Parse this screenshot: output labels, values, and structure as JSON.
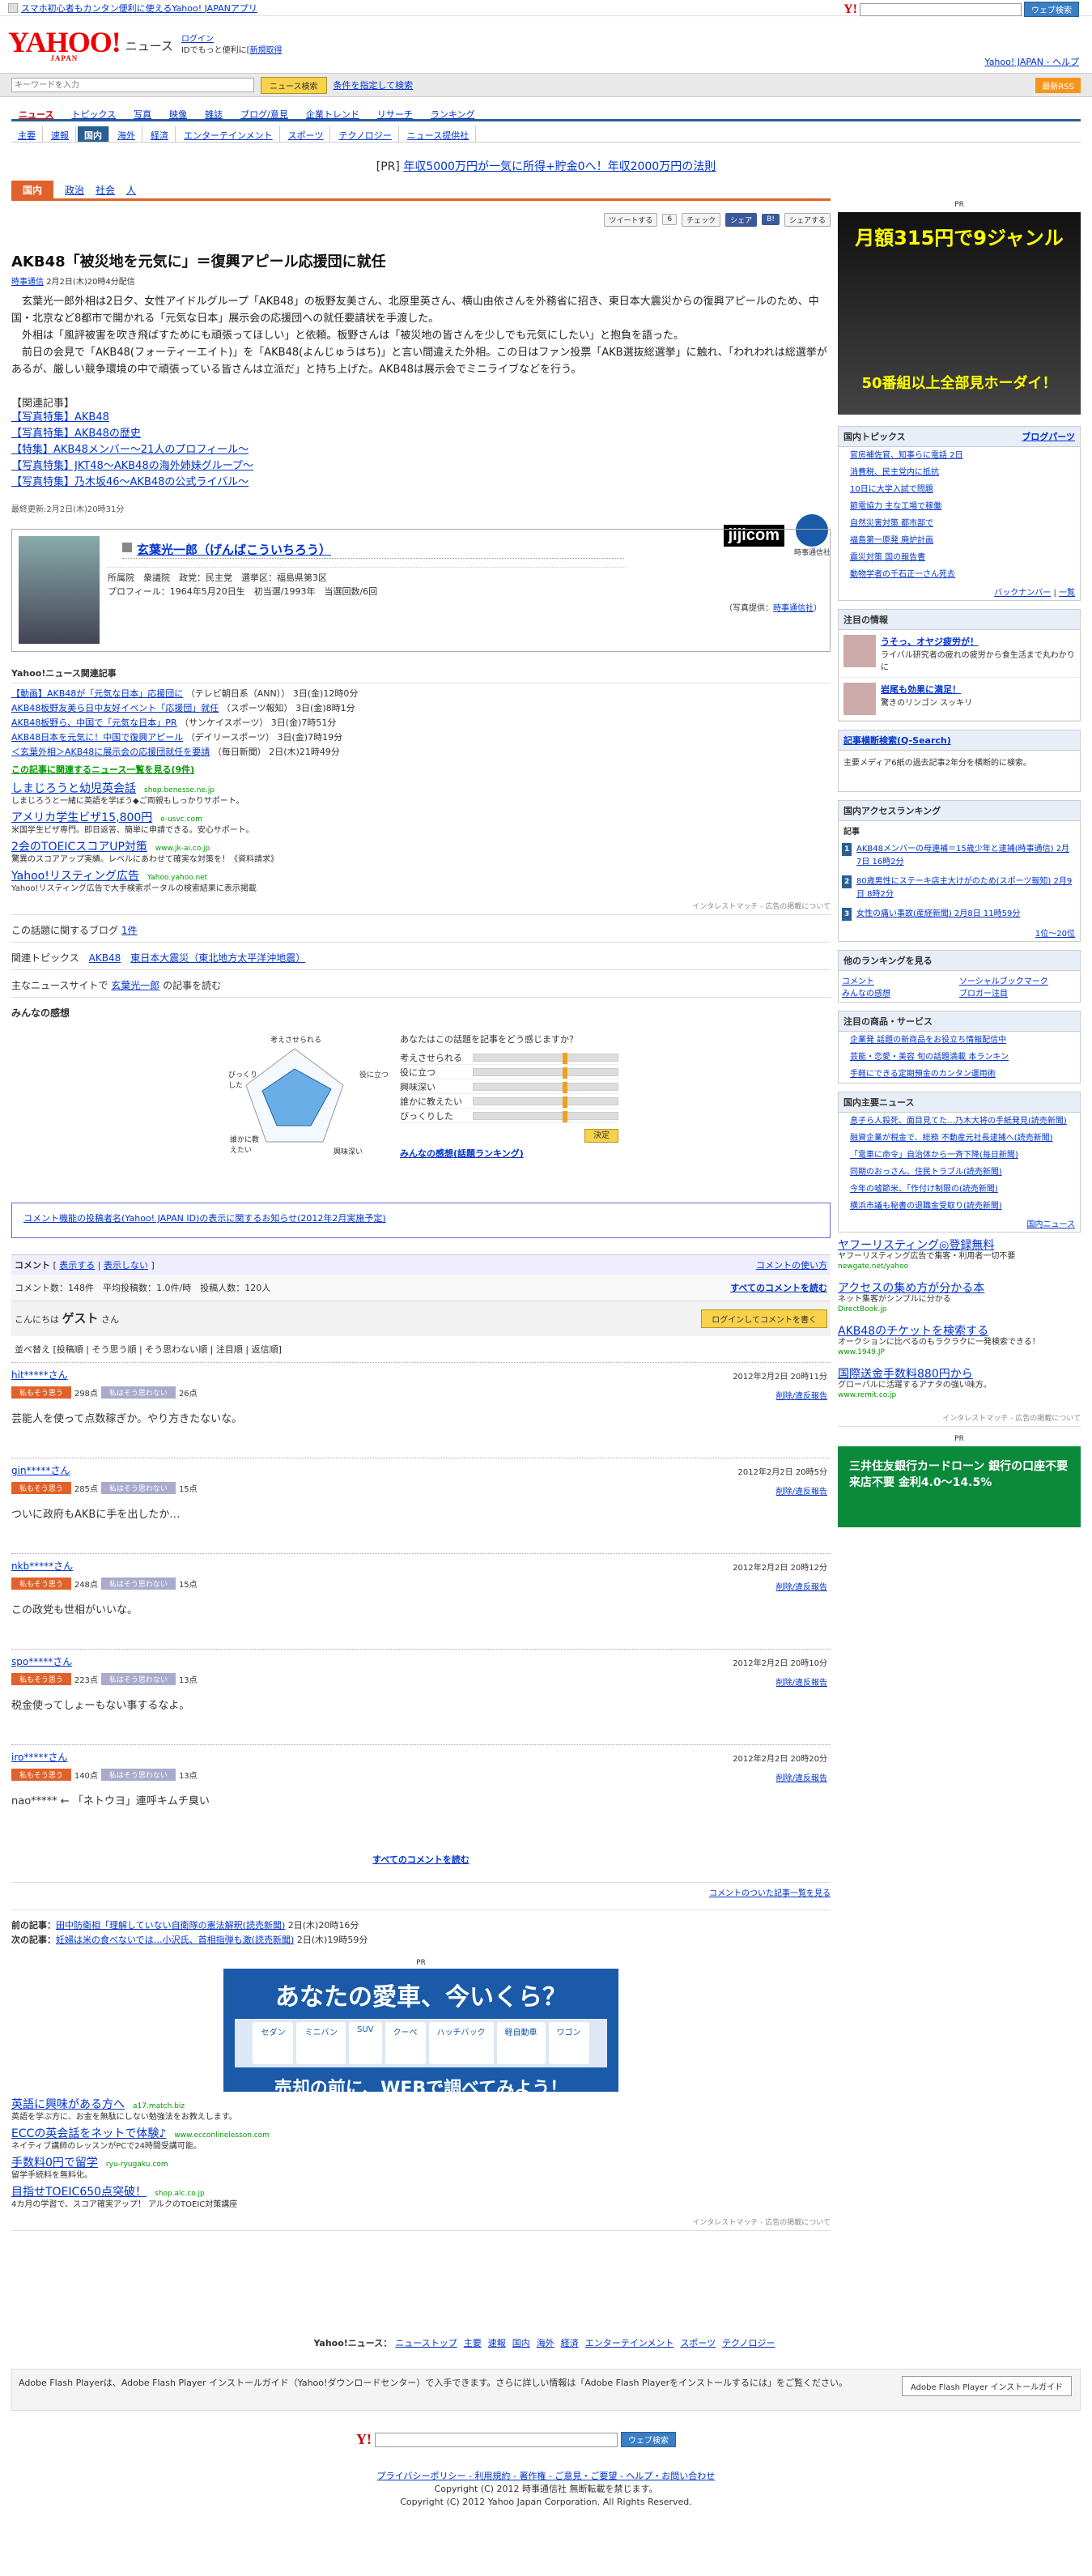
{
  "topbar": {
    "promo": "スマホ初心者もカンタン便利に使えるYahoo! JAPANアプリ",
    "search_btn": "ウェブ検索"
  },
  "header": {
    "logo": "YAHOO!",
    "logo_sub": "JAPAN",
    "section": "ニュース",
    "login": "ログイン",
    "login_sub": "IDでもっと便利に[",
    "signup": "新規取得",
    "right_links": "Yahoo! JAPAN - ヘルプ"
  },
  "keyword": {
    "placeholder": "キーワードを入力",
    "search_btn": "ニュース検索",
    "advanced": "条件を指定して検索",
    "rss": "最新RSS"
  },
  "nav1": [
    "ニュース",
    "トピックス",
    "写真",
    "映像",
    "雑誌",
    "ブログ/意見",
    "企業トレンド",
    "リサーチ",
    "ランキング"
  ],
  "nav2": [
    "主要",
    "速報",
    "国内",
    "海外",
    "経済",
    "エンターテインメント",
    "スポーツ",
    "テクノロジー",
    "ニュース提供社"
  ],
  "pr_line": {
    "prefix": "[PR]",
    "text": "年収5000万円が一気に所得+貯金0へ！年収2000万円の法則"
  },
  "catbar": {
    "active": "国内",
    "items": [
      "政治",
      "社会",
      "人"
    ]
  },
  "share": {
    "tweet": "ツイートする",
    "tweet_count": "6",
    "check": "チェック",
    "fb": "シェア",
    "hatena": "B!",
    "share": "シェアする"
  },
  "article": {
    "headline": "AKB48「被災地を元気に」＝復興アピール応援団に就任",
    "source": "時事通信",
    "date": "2月2日(木)20時4分配信",
    "para1": "玄葉光一郎外相は2日夕、女性アイドルグループ「AKB48」の板野友美さん、北原里英さん、横山由依さんを外務省に招き、東日本大震災からの復興アピールのため、中国・北京など8都市で開かれる「元気な日本」展示会の応援団への就任要請状を手渡した。",
    "para2": "外相は「風評被害を吹き飛ばすためにも頑張ってほしい」と依頼。板野さんは「被災地の皆さんを少しでも元気にしたい」と抱負を語った。",
    "para3": "前日の会見で「AKB48(フォーティーエイト)」を「AKB48(よんじゅうはち)」と言い間違えた外相。この日はファン投票「AKB選抜総選挙」に触れ、「われわれは総選挙があるが、厳しい競争環境の中で頑張っている皆さんは立派だ」と持ち上げた。AKB48は展示会でミニライブなどを行う。",
    "related_head": "【関連記事】",
    "related": [
      "【写真特集】AKB48",
      "【写真特集】AKB48の歴史",
      "【特集】AKB48メンバー〜21人のプロフィール〜",
      "【写真特集】JKT48〜AKB48の海外姉妹グループ〜",
      "【写真特集】乃木坂46〜AKB48の公式ライバル〜"
    ],
    "updated": "最終更新:2月2日(木)20時31分",
    "jiji_logo": "jijicom",
    "jiji_sub": "時事通信社"
  },
  "profile": {
    "name": "玄葉光一郎（げんばこういちろう）",
    "info1": "所属院　衆議院　政党：民主党　選挙区：福島県第3区",
    "info2": "プロフィール：1964年5月20日生　初当選/1993年　当選回数/6回",
    "photo_credit": "（写真提供：",
    "photo_src": "時事通信社",
    "photo_close": "）"
  },
  "yahoo_related": {
    "title": "Yahoo!ニュース関連記事",
    "items": [
      {
        "t": "【動画】AKB48が「元気な日本」応援団に",
        "s": "（テレビ朝日系（ANN））",
        "d": "3日(金)12時0分"
      },
      {
        "t": "AKB48板野友美ら日中友好イベント「応援団」就任",
        "s": "（スポーツ報知）",
        "d": "3日(金)8時1分"
      },
      {
        "t": "AKB48板野ら、中国で「元気な日本」PR",
        "s": "（サンケイスポーツ）",
        "d": "3日(金)7時51分"
      },
      {
        "t": "AKB48日本を元気に！中国で復興アピール",
        "s": "（デイリースポーツ）",
        "d": "3日(金)7時19分"
      },
      {
        "t": "＜玄葉外相＞AKB48に展示会の応援団就任を要請",
        "s": "（毎日新聞）",
        "d": "2日(木)21時49分"
      }
    ],
    "all_link": "この記事に関連するニュース一覧を見る(9件)"
  },
  "ads": [
    {
      "t": "しまじろうと幼児英会話",
      "u": "shop.benesse.ne.jp",
      "d": "しまじろうと一緒に英語を学ぼう◆ご両親もしっかりサポート。"
    },
    {
      "t": "アメリカ学生ビザ15,800円",
      "u": "e-usvc.com",
      "d": "米国学生ビザ専門。即日返答、簡単に申請できる。安心サポート。"
    },
    {
      "t": "2会のTOEICスコアUP対策",
      "u": "www.jk-ai.co.jp",
      "d": "驚異のスコアアップ実績。レベルにあわせて確実な対策を！《資料請求》"
    },
    {
      "t": "Yahoo!リスティング広告",
      "u": "Yahoo.yahoo.net",
      "d": "Yahoo!リスティング広告で大手検索ポータルの検索結果に表示掲載"
    }
  ],
  "adnote": "インタレストマッチ - 広告の掲載について",
  "blog": {
    "label": "この話題に関するブログ",
    "count": "1件"
  },
  "topics": {
    "label": "関連トピックス",
    "items": [
      "AKB48",
      "東日本大震災（東北地方太平洋沖地震）"
    ]
  },
  "mainsite": {
    "label": "主なニュースサイトで",
    "name": "玄葉光一郎",
    "suffix": "の記事を読む"
  },
  "minna": {
    "title": "みんなの感想",
    "question": "あなたはこの話題を記事をどう感じますか？",
    "labels": [
      "考えさせられる",
      "役に立つ",
      "興味深い",
      "誰かに教えたい",
      "びっくりした"
    ],
    "submit": "決定",
    "ranking": "みんなの感想(話題ランキング)"
  },
  "notice": "コメント機能の投稿者名(Yahoo! JAPAN ID)の表示に関するお知らせ(2012年2月実施予定)",
  "comments": {
    "label": "コメント",
    "show": "表示する",
    "hide": "表示しない",
    "howto": "コメントの使い方",
    "count": "コメント数：148件",
    "avg": "平均投稿数：1.0件/時",
    "users": "投稿人数：120人",
    "readall": "すべてのコメントを読む",
    "hello": "こんにちは",
    "guest": "ゲスト",
    "san": "さん",
    "login": "ログインしてコメントを書く",
    "sort": "並べ替え [投稿順 | そう思う順 | そう思わない順 | 注目順 | 返信順]",
    "items": [
      {
        "u": "hit*****さん",
        "d": "2012年2月2日 20時11分",
        "good": "298点",
        "bad": "26点",
        "txt": "芸能人を使って点数稼ぎか。やり方きたないな。"
      },
      {
        "u": "gin*****さん",
        "d": "2012年2月2日 20時5分",
        "good": "285点",
        "bad": "15点",
        "txt": "ついに政府もAKBに手を出したか…"
      },
      {
        "u": "nkb*****さん",
        "d": "2012年2月2日 20時12分",
        "good": "248点",
        "bad": "15点",
        "txt": "この政党も世相がいいな。"
      },
      {
        "u": "spo*****さん",
        "d": "2012年2月2日 20時10分",
        "good": "223点",
        "bad": "13点",
        "txt": "税金使ってしょーもない事するなよ。"
      },
      {
        "u": "iro*****さん",
        "d": "2012年2月2日 20時20分",
        "good": "140点",
        "bad": "13点",
        "txt": "nao***** ← 「ネトウヨ」連呼キムチ臭い"
      }
    ],
    "vote_yes": "私もそう思う",
    "vote_no": "私はそう思わない",
    "report": "削除/違反報告",
    "all": "すべてのコメントを読む",
    "commented": "コメントのついた記事一覧を見る"
  },
  "prevnext": {
    "prev_label": "前の記事：",
    "prev": "田中防衛相「理解していない自衛隊の憲法解釈(読売新聞)",
    "prev_d": "2日(木)20時16分",
    "next_label": "次の記事：",
    "next": "妊婦は米の食べないでは…小沢氏、首相指弾も激(読売新聞)",
    "next_d": "2日(木)19時59分"
  },
  "banner": {
    "pr": "PR",
    "title": "あなたの愛車、今いくら？",
    "cars": [
      "セダン",
      "ミニバン",
      "SUV",
      "クーペ",
      "ハッチバック",
      "軽自動車",
      "ワゴン"
    ],
    "foot": "売却の前に、WEBで調べてみよう！"
  },
  "ads2": [
    {
      "t": "英語に興味がある方へ",
      "u": "a17.match.biz",
      "d": "英語を学ぶ方に、お金を無駄にしない勉強法をお教えします。"
    },
    {
      "t": "ECCの英会話をネットで体験♪",
      "u": "www.ecconlinelesson.com",
      "d": "ネイティブ講師のレッスンがPCで24時間受講可能。"
    },
    {
      "t": "手数料0円で留学",
      "u": "ryu-ryugaku.com",
      "d": "留学手続料を無料化。"
    },
    {
      "t": "目指せTOEIC650点突破！",
      "u": "shop.alc.co.jp",
      "d": "4カ月の学習で、スコア確実アップ！ アルクのTOEIC対策講座"
    }
  ],
  "bottom_nav": {
    "label": "Yahoo!ニュース：",
    "items": [
      "ニューストップ",
      "主要",
      "速報",
      "国内",
      "海外",
      "経済",
      "エンターテインメント",
      "スポーツ",
      "テクノロジー"
    ]
  },
  "flash": {
    "text": "Adobe Flash Playerは、Adobe Flash Player インストールガイド（Yahoo!ダウンロードセンター）で入手できます。さらに詳しい情報は「Adobe Flash Playerをインストールするには」をご覧ください。",
    "btn": "Adobe Flash Player インストールガイド"
  },
  "footer": {
    "links": "プライバシーポリシー - 利用規約 - 著作権 - ご意見・ご要望 - ヘルプ・お問い合わせ",
    "c1": "Copyright (C) 2012 時事通信社 無断転載を禁じます。",
    "c2": "Copyright (C) 2012 Yahoo Japan Corporation. All Rights Reserved."
  },
  "right": {
    "pr": "PR",
    "pr_text": "月額315円で9ジャンル",
    "pr_bottom": "50番組以上全部見ホーダイ！",
    "topics_title": "国内トピックス",
    "topics_link": "ブログパーツ",
    "topics": [
      "官房補佐官、知事らに電話 2日",
      "消費税、民主党内に抵抗",
      "10日に大学入試で問題",
      "節電協力 主な工場で稼働",
      "自然災害対策 都市部で",
      "福島第一原発 廃炉計画",
      "震災対策 国の報告書",
      "動物学者の千石正一さん死去"
    ],
    "back": "バックナンバー",
    "list": "一覧",
    "attn_title": "注目の情報",
    "attn": [
      {
        "t": "うそっ、オヤジ疲労が！",
        "d": "ライバル研究者の疲れの疲労から食生活まで丸わかりに"
      },
      {
        "t": "岩尾も効果に満足！",
        "d": "驚きのリンゴン スッキリ"
      }
    ],
    "kiji_title": "記事横断検索(Q-Search)",
    "kiji": "主要メディア6紙の過去記事2年分を横断的に検索。",
    "rank_title": "国内アクセスランキング",
    "rank_sub": "記事",
    "rank": [
      {
        "n": "1",
        "t": "AKB48メンバーの母連補＝15歳少年と逮捕(時事通信)",
        "d": "2月7日 16時2分"
      },
      {
        "n": "2",
        "t": "80歳男性にステーキ店主大けがのため(スポーツ報知)",
        "d": "2月9日 8時2分"
      },
      {
        "n": "3",
        "t": "女性の痛い事故(産経新聞)",
        "d": "2月8日 11時59分"
      }
    ],
    "rank_all": "1位〜20位",
    "other_title": "他のランキングを見る",
    "others": [
      "コメント",
      "ソーシャルブックマーク",
      "みんなの感想",
      "ブロガー注目"
    ],
    "goods_title": "注目の商品・サービス",
    "goods": [
      "企業発 話題の新商品をお役立ち情報配信中",
      "芸能・恋愛・美容 旬の話題満載 本ランキン",
      "手軽にできる定期預金のカンタン運用術"
    ],
    "major_title": "国内主要ニュース",
    "major": [
      "息子ら人殺死、面目見てた…乃木大将の手紙発見(読売新聞)",
      "融資企業が税金で、総務 不動産元社長逮捕へ(読売新聞)",
      "「電車に命令」自治体から一斉下降(毎日新聞)",
      "同期のおっさん、住民トラブル(読売新聞)",
      "今年の嘘節米、「作付け制限の(読売新聞)",
      "横浜市議も秘書の退職金受取り(読売新聞)"
    ],
    "major_more": "国内ニュース",
    "listing": [
      {
        "t": "ヤフーリスティング◎登録無料",
        "d": "ヤフーリスティング広告で集客・利用者一切不要",
        "u": "newgate.net/yahoo"
      },
      {
        "t": "アクセスの集め方が分かる本",
        "d": "ネット集客がシンプルに分かる",
        "u": "DirectBook.jp"
      },
      {
        "t": "AKB48のチケットを検索する",
        "d": "オークションに比べるのもラクラクに一発検索できる！",
        "u": "www.1949.JP"
      },
      {
        "t": "国際送金手数料880円から",
        "d": "グローバルに活躍するアナタの強い味方。",
        "u": "www.remit.co.jp"
      }
    ],
    "bottom_pr": "三井住友銀行カードローン 銀行の口座不要 来店不要 金利4.0〜14.5%"
  }
}
